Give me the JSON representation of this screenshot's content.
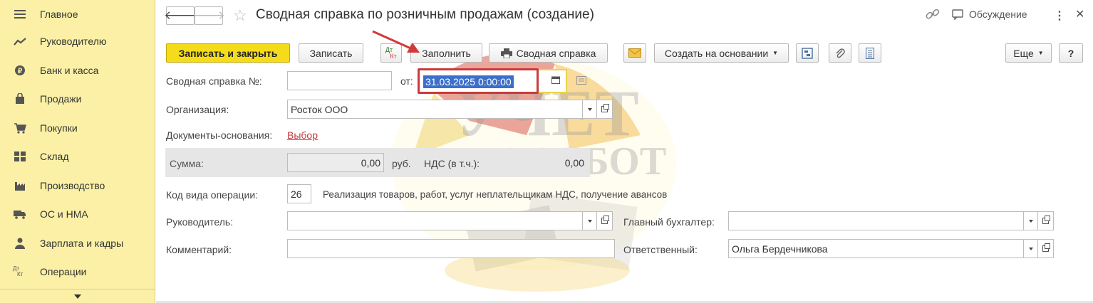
{
  "sidebar": {
    "items": [
      {
        "label": "Главное",
        "icon": "menu-lines-icon"
      },
      {
        "label": "Руководителю",
        "icon": "trend-chart-icon"
      },
      {
        "label": "Банк и касса",
        "icon": "coin-icon"
      },
      {
        "label": "Продажи",
        "icon": "shopping-bag-icon"
      },
      {
        "label": "Покупки",
        "icon": "cart-icon"
      },
      {
        "label": "Склад",
        "icon": "warehouse-grid-icon"
      },
      {
        "label": "Производство",
        "icon": "factory-icon"
      },
      {
        "label": "ОС и НМА",
        "icon": "truck-icon"
      },
      {
        "label": "Зарплата и кадры",
        "icon": "person-icon"
      },
      {
        "label": "Операции",
        "icon": "dt-kt-icon"
      }
    ]
  },
  "header": {
    "title": "Сводная справка по розничным продажам (создание)",
    "discussion_label": "Обсуждение"
  },
  "toolbar": {
    "save_close": "Записать и закрыть",
    "save": "Записать",
    "dtkt_top": "Дт",
    "dtkt_bottom": "Кт",
    "fill": "Заполнить",
    "summary": "Сводная справка",
    "create_based": "Создать на основании",
    "more": "Еще",
    "help": "?"
  },
  "form": {
    "number_label": "Сводная справка №:",
    "number_value": "",
    "date_label": "от:",
    "date_value": "31.03.2025  0:00:00",
    "org_label": "Организация:",
    "org_value": "Росток ООО",
    "docs_label": "Документы-основания:",
    "docs_link": "Выбор",
    "sum_label": "Сумма:",
    "sum_value": "0,00",
    "currency": "руб.",
    "vat_label": "НДС (в т.ч.):",
    "vat_value": "0,00",
    "opcode_label": "Код вида операции:",
    "opcode_value": "26",
    "opcode_desc": "Реализация товаров, работ, услуг неплательщикам НДС, получение авансов",
    "head_label": "Руководитель:",
    "head_value": "",
    "chief_acc_label": "Главный бухгалтер:",
    "chief_acc_value": "",
    "comment_label": "Комментарий:",
    "comment_value": "",
    "responsible_label": "Ответственный:",
    "responsible_value": "Ольга Бердечникова"
  },
  "watermark": {
    "line1": "УЧЕТ",
    "line2": "БЕЗ ЗАБОТ"
  },
  "colors": {
    "sidebar_bg": "#fbf0a6",
    "primary_button": "#f5dc1b",
    "selection": "#3b6fc9",
    "highlight_red": "#c93b3b",
    "link": "#c23c3c"
  }
}
